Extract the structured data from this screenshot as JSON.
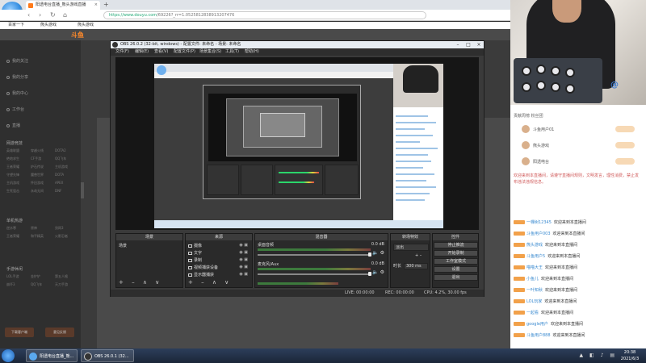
{
  "browser": {
    "tab_title": "阳透电台直播_熊头游戏直播",
    "tab_close": "×",
    "new_tab": "+",
    "nav": {
      "back": "‹",
      "forward": "›",
      "reload": "↻",
      "home": "⌂"
    },
    "address_domain": "https://www.douyu.com",
    "address_rest": "/69226?_rr=1.0525812838913207476",
    "bookmarks": [
      "百家一下",
      "熊头游戏",
      "熊头游戏"
    ]
  },
  "site": {
    "logo": "斗鱼",
    "nav_items": [
      "我的关注",
      "我的分享",
      "我的中心",
      "工作台",
      "直播"
    ],
    "section_titles": [
      "网游竞技",
      "单机热游",
      "手游休闲"
    ],
    "categories": [
      [
        "英雄联盟",
        "穿越火线",
        "DOTA2"
      ],
      [
        "绝地求生",
        "CF手游",
        "QQ飞车"
      ],
      [
        "王者荣耀",
        "炉石传说",
        "主机游戏"
      ],
      [
        "守望先锋",
        "魔兽世界",
        "DOTA"
      ],
      [
        "主机游戏",
        "怀旧游戏",
        "APEX"
      ],
      [
        "生死狙击",
        "永劫无间",
        "DNF"
      ],
      [
        "逆水寒",
        "原神",
        "剑网3"
      ],
      [
        "王者荣耀",
        "和平精英",
        "火影忍者"
      ],
      [
        "LOL手游",
        "金铲铲",
        "第五人格"
      ],
      [
        "崩坏3",
        "QQ飞车",
        "天刀手游"
      ]
    ],
    "bottom_buttons": [
      "下载客户端",
      "意见反馈"
    ]
  },
  "obs": {
    "title": "OBS 26.0.2 (32-bit, windows) - 配置文件: 未命名 - 场景: 未命名",
    "win_controls": [
      "–",
      "□",
      "×"
    ],
    "menu": [
      "文件(F)",
      "编辑(E)",
      "查看(V)",
      "配置文件(P)",
      "场景集合(S)",
      "工具(T)",
      "帮助(H)"
    ],
    "docks": {
      "scenes": {
        "title": "场景",
        "items": [
          "场景"
        ]
      },
      "sources": {
        "title": "来源",
        "items": [
          "摄像",
          "文字",
          "录制",
          "视频捕获设备",
          "显示器捕获"
        ]
      },
      "mixer": {
        "title": "混音器",
        "channels": [
          {
            "name": "桌面音频",
            "db": "0.0 dB"
          },
          {
            "name": "麦克风/Aux",
            "db": "0.0 dB"
          }
        ]
      },
      "transitions": {
        "title": "转场特效",
        "type": "淡出",
        "duration_label": "时长",
        "duration": "300 ms"
      },
      "controls": {
        "title": "控件",
        "buttons": [
          "停止推流",
          "开始录制",
          "工作室模式",
          "设置",
          "退出"
        ]
      }
    },
    "tools_glyphs": "+ – ∧ ∨",
    "status": [
      "LIVE: 00:00:00",
      "REC: 00:00:00",
      "CPU: 4.2%, 30.00 fps"
    ]
  },
  "chat": {
    "header": "贡献周榜  粉丝团",
    "ranks": [
      "斗鱼用户01",
      "熊头游戏",
      "阳透电台"
    ],
    "notice": "欢迎来到本直播间，请遵守直播间规则，文明发言，理性消费，禁止发布违法违规信息。",
    "messages": [
      {
        "user": "一棵树12345",
        "text": "欢迎来到本直播间"
      },
      {
        "user": "斗鱼用户003",
        "text": "欢迎来到本直播间"
      },
      {
        "user": "熊头游戏",
        "text": "欢迎来到本直播间"
      },
      {
        "user": "斗鱼用户5",
        "text": "欢迎来到本直播间"
      },
      {
        "user": "喵喵大王",
        "text": "欢迎来到本直播间"
      },
      {
        "user": "小鱼儿",
        "text": "欢迎来到本直播间"
      },
      {
        "user": "一叶知秋",
        "text": "欢迎来到本直播间"
      },
      {
        "user": "LOL玩家",
        "text": "欢迎来到本直播间"
      },
      {
        "user": "一起看",
        "text": "欢迎来到本直播间"
      },
      {
        "user": "google用户",
        "text": "欢迎来到本直播间"
      },
      {
        "user": "斗鱼用户888",
        "text": "欢迎来到本直播间"
      }
    ]
  },
  "taskbar": {
    "tasks": [
      "阳透电台直播_熊...",
      "OBS 26.0.1 (32..."
    ],
    "tray": "▲ ◧ ♪ ▤",
    "time": "20:38",
    "date": "2021/6/3"
  },
  "colors": {
    "accent": "#ff7a1a",
    "obs_bg": "#2a2a2a",
    "chat_user": "#3a8ad0",
    "taskbar": "#1b2638"
  }
}
